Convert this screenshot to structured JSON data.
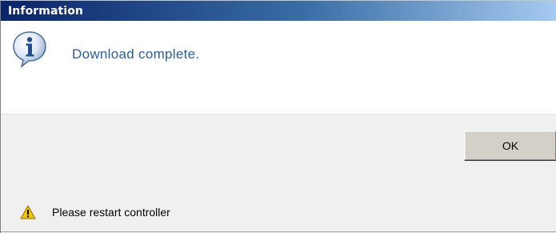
{
  "window": {
    "title": "Information"
  },
  "message": {
    "text": "Download complete.",
    "icon": "info-icon"
  },
  "buttons": {
    "ok_label": "OK"
  },
  "status": {
    "text": "Please restart controller",
    "icon": "warning-icon"
  },
  "colors": {
    "title_bar_start": "#0a246a",
    "title_bar_end": "#a6caf0",
    "message_text": "#2a5d9f",
    "warning": "#f5c400"
  }
}
